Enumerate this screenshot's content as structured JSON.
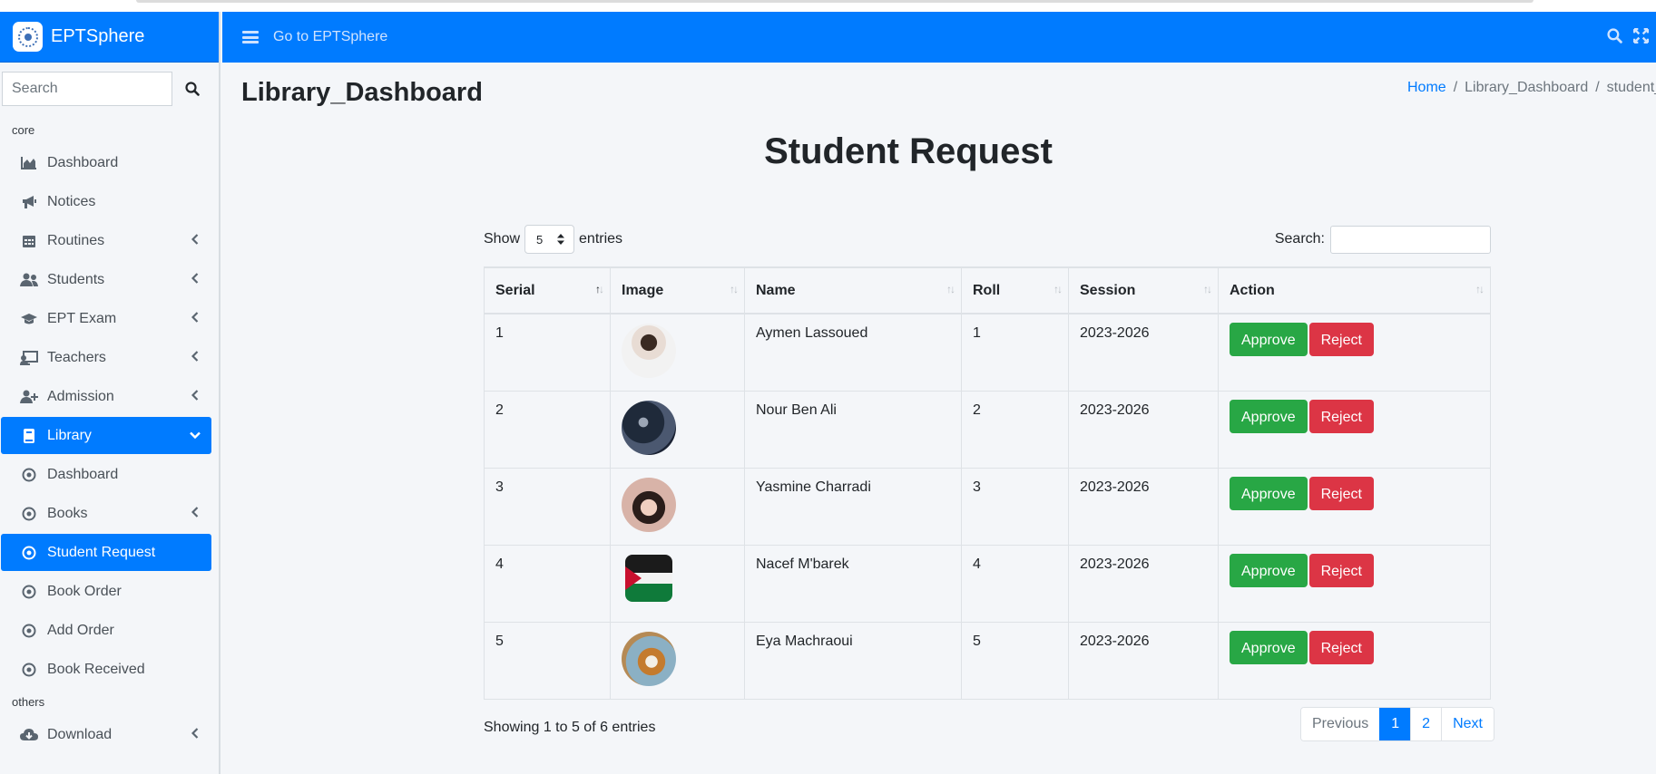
{
  "app": {
    "brand": "EPTSphere",
    "goto_label": "Go to EPTSphere"
  },
  "sidebar": {
    "search_placeholder": "Search",
    "sections": {
      "core": "core",
      "others": "others"
    },
    "items": [
      {
        "label": "Dashboard",
        "icon": "chart-area-icon"
      },
      {
        "label": "Notices",
        "icon": "bullhorn-icon"
      },
      {
        "label": "Routines",
        "icon": "calendar-icon"
      },
      {
        "label": "Students",
        "icon": "users-icon"
      },
      {
        "label": "EPT Exam",
        "icon": "graduation-cap-icon"
      },
      {
        "label": "Teachers",
        "icon": "chalkboard-teacher-icon"
      },
      {
        "label": "Admission",
        "icon": "user-plus-icon"
      },
      {
        "label": "Library",
        "icon": "book-icon"
      },
      {
        "label": "Dashboard",
        "icon": "circle-dot-icon"
      },
      {
        "label": "Books",
        "icon": "circle-dot-icon"
      },
      {
        "label": "Student Request",
        "icon": "circle-dot-icon"
      },
      {
        "label": "Book Order",
        "icon": "circle-dot-icon"
      },
      {
        "label": "Add Order",
        "icon": "circle-dot-icon"
      },
      {
        "label": "Book Received",
        "icon": "circle-dot-icon"
      },
      {
        "label": "Download",
        "icon": "cloud-download-icon"
      }
    ]
  },
  "page": {
    "title": "Library_Dashboard",
    "breadcrumb": {
      "home": "Home",
      "middle": "Library_Dashboard",
      "current": "student_request"
    },
    "heading": "Student Request"
  },
  "table": {
    "show_label": "Show",
    "entries_label": "entries",
    "length_value": "5",
    "search_label": "Search:",
    "columns": [
      "Serial",
      "Image",
      "Name",
      "Roll",
      "Session",
      "Action"
    ],
    "rows": [
      {
        "serial": "1",
        "name": "Aymen Lassoued",
        "roll": "1",
        "session": "2023-2026"
      },
      {
        "serial": "2",
        "name": "Nour Ben Ali",
        "roll": "2",
        "session": "2023-2026"
      },
      {
        "serial": "3",
        "name": "Yasmine Charradi",
        "roll": "3",
        "session": "2023-2026"
      },
      {
        "serial": "4",
        "name": "Nacef M'barek",
        "roll": "4",
        "session": "2023-2026"
      },
      {
        "serial": "5",
        "name": "Eya Machraoui",
        "roll": "5",
        "session": "2023-2026"
      }
    ],
    "approve_label": "Approve",
    "reject_label": "Reject",
    "info": "Showing 1 to 5 of 6 entries",
    "pager": {
      "previous": "Previous",
      "page1": "1",
      "page2": "2",
      "next": "Next"
    }
  },
  "colors": {
    "primary": "#007bff",
    "approve": "#28a745",
    "reject": "#dc3545"
  }
}
